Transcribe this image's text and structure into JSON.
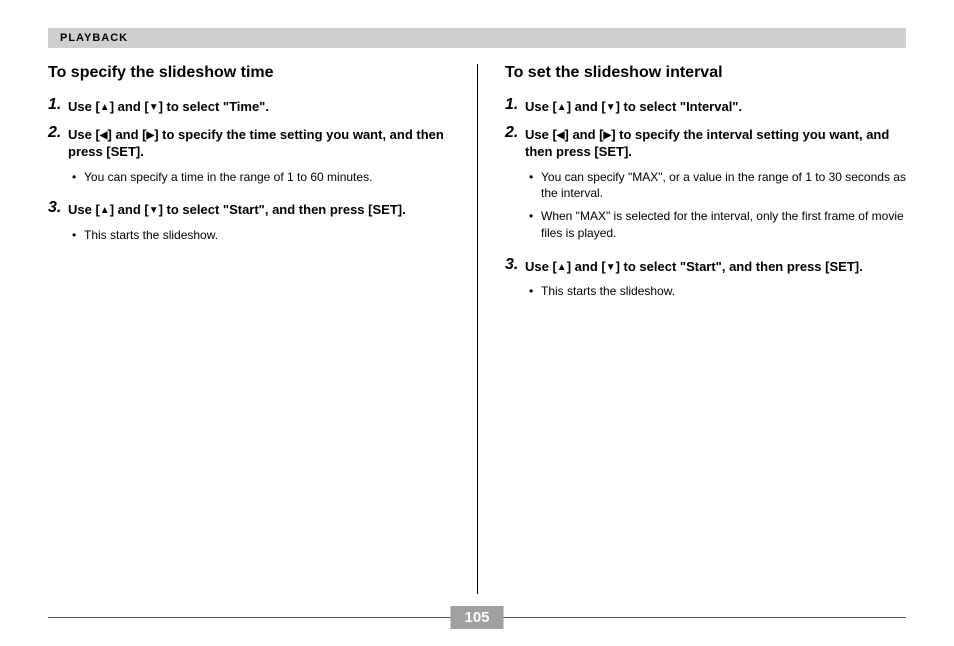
{
  "header": "PLAYBACK",
  "page_number": "105",
  "glyph": {
    "up": "▲",
    "down": "▼",
    "left": "◀",
    "right": "▶"
  },
  "left": {
    "title": "To specify the slideshow time",
    "steps": [
      {
        "num": "1.",
        "pre": "Use [",
        "a1": "up",
        "mid1": "] and [",
        "a2": "down",
        "post": "] to select \"Time\".",
        "bullets": []
      },
      {
        "num": "2.",
        "pre": "Use [",
        "a1": "left",
        "mid1": "] and [",
        "a2": "right",
        "post": "] to specify the time setting you want, and then press [SET].",
        "bullets": [
          "You can specify a time in the range of 1 to 60 minutes."
        ]
      },
      {
        "num": "3.",
        "pre": "Use [",
        "a1": "up",
        "mid1": "] and [",
        "a2": "down",
        "post": "] to select \"Start\", and then press [SET].",
        "bullets": [
          "This starts the slideshow."
        ]
      }
    ]
  },
  "right": {
    "title": "To set the slideshow interval",
    "steps": [
      {
        "num": "1.",
        "pre": "Use [",
        "a1": "up",
        "mid1": "] and [",
        "a2": "down",
        "post": "] to select \"Interval\".",
        "bullets": []
      },
      {
        "num": "2.",
        "pre": "Use [",
        "a1": "left",
        "mid1": "] and [",
        "a2": "right",
        "post": "] to specify the interval setting you want, and then press [SET].",
        "bullets": [
          "You can specify \"MAX\", or a value in the range of 1 to 30 seconds as the interval.",
          "When \"MAX\" is selected for the interval, only the first frame of movie files is played."
        ]
      },
      {
        "num": "3.",
        "pre": "Use [",
        "a1": "up",
        "mid1": "] and [",
        "a2": "down",
        "post": "] to select \"Start\", and then press [SET].",
        "bullets": [
          "This starts the slideshow."
        ]
      }
    ]
  }
}
